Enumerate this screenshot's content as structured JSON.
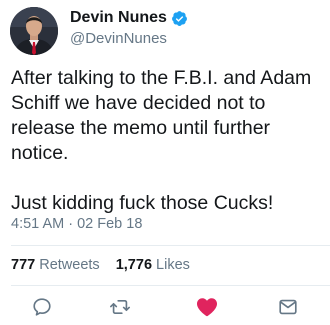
{
  "author": {
    "name": "Devin Nunes",
    "handle": "@DevinNunes",
    "verified": true
  },
  "tweet": {
    "paragraphs": [
      "After talking to the F.B.I. and Adam Schiff we have decided not to release the memo until further notice.",
      "Just kidding fuck those Cucks!"
    ],
    "timestamp": "4:51 AM · 02 Feb 18"
  },
  "stats": {
    "retweets_count": "777",
    "retweets_label": "Retweets",
    "likes_count": "1,776",
    "likes_label": "Likes"
  },
  "actions": [
    {
      "icon": "reply-icon"
    },
    {
      "icon": "retweet-icon"
    },
    {
      "icon": "like-icon",
      "active": true
    },
    {
      "icon": "direct-message-icon"
    }
  ],
  "colors": {
    "verified": "#1da1f2",
    "muted": "#657786",
    "like_active": "#e0245e",
    "divider": "#e6ecf0"
  }
}
